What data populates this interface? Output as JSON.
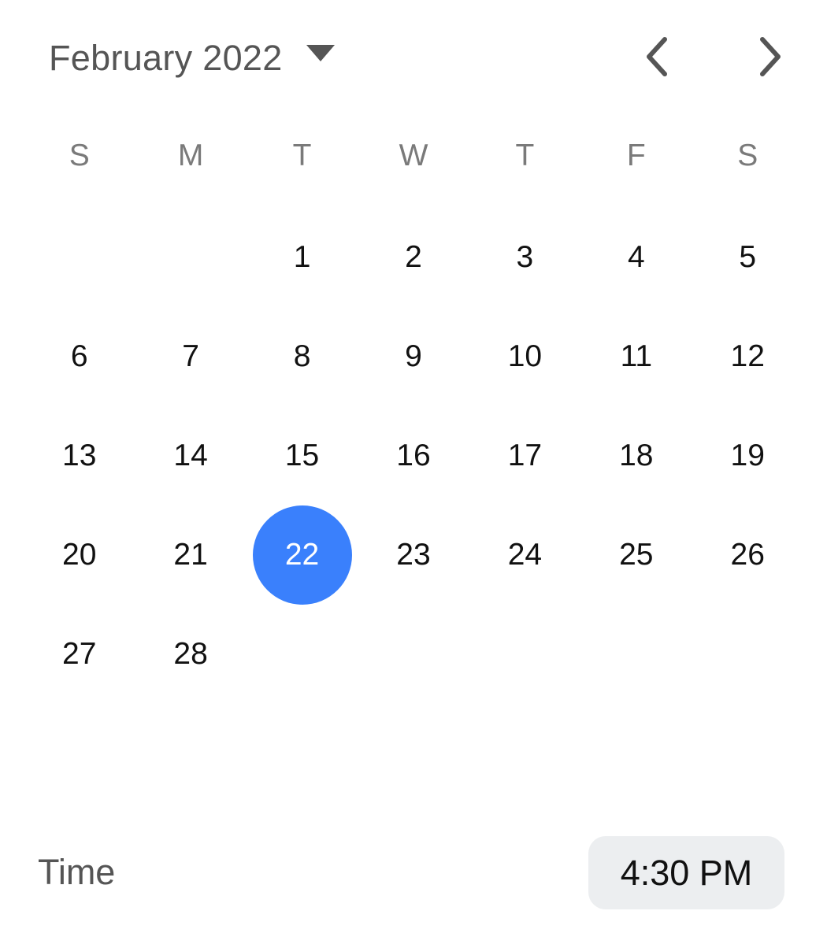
{
  "header": {
    "month_year": "February 2022"
  },
  "weekdays": [
    "S",
    "M",
    "T",
    "W",
    "T",
    "F",
    "S"
  ],
  "calendar": {
    "leading_blanks": 2,
    "days": [
      "1",
      "2",
      "3",
      "4",
      "5",
      "6",
      "7",
      "8",
      "9",
      "10",
      "11",
      "12",
      "13",
      "14",
      "15",
      "16",
      "17",
      "18",
      "19",
      "20",
      "21",
      "22",
      "23",
      "24",
      "25",
      "26",
      "27",
      "28"
    ],
    "selected_day": "22"
  },
  "time": {
    "label": "Time",
    "value": "4:30 PM"
  },
  "colors": {
    "accent": "#3a80fc",
    "time_button_bg": "#eceef0",
    "muted_text": "#555555",
    "weekday_text": "#7a7a7a"
  }
}
